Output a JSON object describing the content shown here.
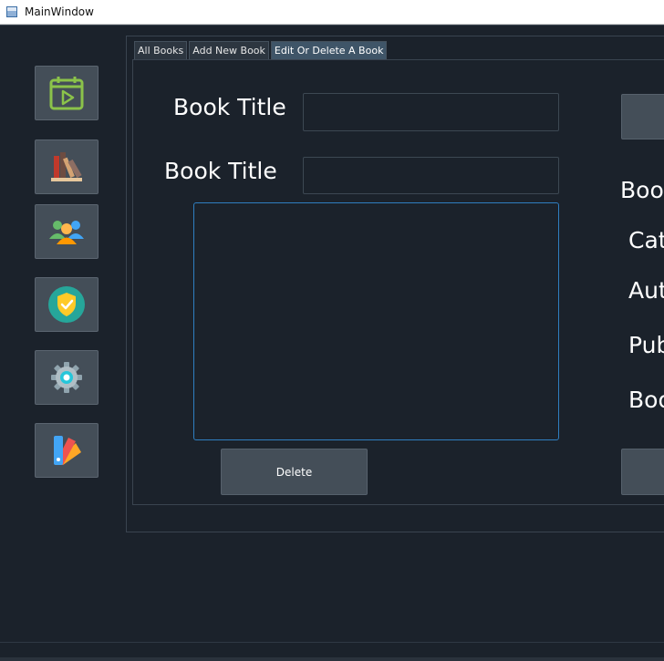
{
  "window": {
    "title": "MainWindow"
  },
  "sidebar": {
    "items": [
      {
        "icon": "calendar-play-icon"
      },
      {
        "icon": "books-icon"
      },
      {
        "icon": "users-icon"
      },
      {
        "icon": "shield-check-icon"
      },
      {
        "icon": "gear-icon"
      },
      {
        "icon": "color-palette-icon"
      }
    ]
  },
  "tabs": [
    {
      "label": "All Books",
      "active": false
    },
    {
      "label": "Add New Book",
      "active": false
    },
    {
      "label": "Edit Or Delete A Book",
      "active": true
    }
  ],
  "left_form": {
    "book_title_label": "Book Title",
    "book_title_value": "",
    "book_title_label_2": "Book Title",
    "book_title_value_2": "",
    "description_value": "",
    "delete_button": "Delete"
  },
  "right_form": {
    "labels": [
      "Boo",
      "Cat",
      "Aut",
      "Pub",
      "Boo"
    ]
  },
  "colors": {
    "background": "#1b222b",
    "button": "#444e58",
    "accent_border": "#2f7fc1"
  }
}
